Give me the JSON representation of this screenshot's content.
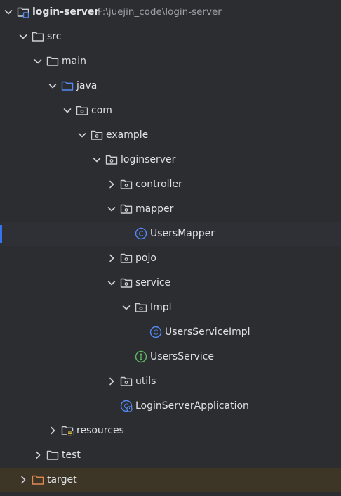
{
  "project": {
    "name": "login-server",
    "path": "F:\\juejin_code\\login-server"
  },
  "colors": {
    "background": "#2b2d30",
    "text": "#dfe1e5",
    "folder": "#ced0d6",
    "source_folder": "#548af7",
    "excluded_folder": "#e08855",
    "class_icon": "#548af7",
    "interface_icon": "#5fb865",
    "selection_marker": "#3574f0",
    "excluded_bg": "#3d3526"
  },
  "tree": [
    {
      "label": "src",
      "icon": "folder-icon",
      "state": "expanded"
    },
    {
      "label": "main",
      "icon": "folder-icon",
      "state": "expanded"
    },
    {
      "label": "java",
      "icon": "source-folder-icon",
      "state": "expanded"
    },
    {
      "label": "com",
      "icon": "package-icon",
      "state": "expanded"
    },
    {
      "label": "example",
      "icon": "package-icon",
      "state": "expanded"
    },
    {
      "label": "loginserver",
      "icon": "package-icon",
      "state": "expanded"
    },
    {
      "label": "controller",
      "icon": "package-icon",
      "state": "collapsed"
    },
    {
      "label": "mapper",
      "icon": "package-icon",
      "state": "expanded"
    },
    {
      "label": "UsersMapper",
      "icon": "class-icon",
      "state": "leaf",
      "selected": true
    },
    {
      "label": "pojo",
      "icon": "package-icon",
      "state": "collapsed"
    },
    {
      "label": "service",
      "icon": "package-icon",
      "state": "expanded"
    },
    {
      "label": "Impl",
      "icon": "package-icon",
      "state": "expanded"
    },
    {
      "label": "UsersServiceImpl",
      "icon": "class-icon",
      "state": "leaf"
    },
    {
      "label": "UsersService",
      "icon": "interface-icon",
      "state": "leaf"
    },
    {
      "label": "utils",
      "icon": "package-icon",
      "state": "collapsed"
    },
    {
      "label": "LoginServerApplication",
      "icon": "spring-boot-class-icon",
      "state": "leaf"
    },
    {
      "label": "resources",
      "icon": "resources-folder-icon",
      "state": "collapsed"
    },
    {
      "label": "test",
      "icon": "folder-icon",
      "state": "collapsed"
    },
    {
      "label": "target",
      "icon": "excluded-folder-icon",
      "state": "collapsed",
      "excluded": true
    }
  ]
}
